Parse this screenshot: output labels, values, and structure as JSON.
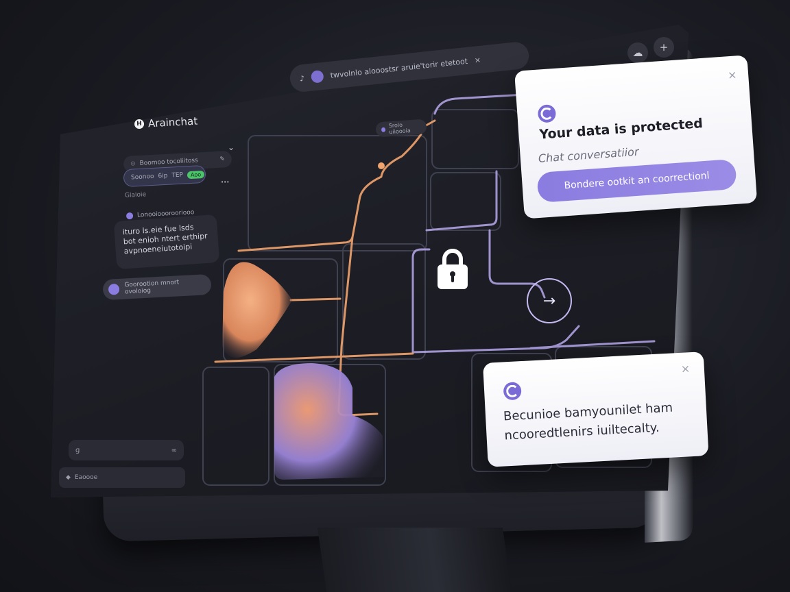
{
  "window": {
    "top_buttons": [
      {
        "icon": "cloud-icon",
        "glyph": "☁"
      },
      {
        "icon": "plus-icon",
        "glyph": "+"
      }
    ]
  },
  "url_bar": {
    "text": "twvolnlo alooostsr aruie'torir etetoot",
    "close_glyph": "×",
    "left_glyph": "♪"
  },
  "brand": {
    "logo_letter": "H",
    "name": "Arainchat"
  },
  "sidebar": {
    "collapse_glyph": "⌄",
    "row1_label": "Boomoo tocoliitoss",
    "row2_left": "Soonoo",
    "row2_mid": "6ip",
    "row2_code": "TEP",
    "row2_badge": "Aoo",
    "row3_label": "Glaioie",
    "row4_label": "Lonooiooorooriooo",
    "message_lines": [
      "ituro ls.eie fue lsds",
      "bot enioh ntert erthipr",
      "avpnoeneiutotoipi"
    ],
    "pill_text": "Goorootion mnort ovoloiog",
    "input_placeholder": "ɡ",
    "input_icon": "∞",
    "footer_text": "Eaoooe",
    "pencil_glyph": "✎",
    "more_glyph": "•••"
  },
  "map": {
    "tag_text": "Srolo uiioooia"
  },
  "popup_top": {
    "title": "Your data is protected",
    "subtitle": "Chat conversatiior",
    "button": "Bondere ootkit an coorrectionl",
    "close_glyph": "×"
  },
  "popup_bottom": {
    "line1": "Becunioe bamyounilet ham",
    "line2": "ncooredtlenirs iuiltecalty.",
    "close_glyph": "×"
  },
  "colors": {
    "accent": "#8a7ce0",
    "orange_path": "#f2a46e",
    "purple_path": "#b7a8ec",
    "badge_green": "#4cc46a"
  }
}
